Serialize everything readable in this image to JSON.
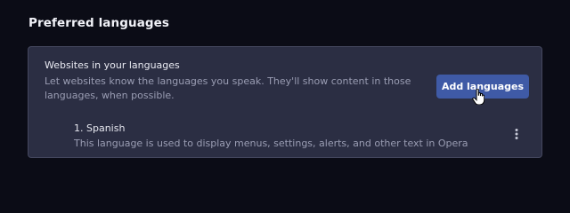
{
  "section": {
    "title": "Preferred languages"
  },
  "websites_languages": {
    "title": "Websites in your languages",
    "description": "Let websites know the languages you speak. They'll show content in those languages, when possible.",
    "add_button_label": "Add languages"
  },
  "languages": [
    {
      "label": "1. Spanish",
      "description": "This language is used to display menus, settings, alerts, and other text in Opera"
    }
  ],
  "icons": {
    "more": "more-vertical-icon",
    "cursor": "hand-pointer-cursor"
  },
  "colors": {
    "background": "#0b0c16",
    "card": "#2b2e43",
    "accent_button": "#3f5aa6",
    "secondary_text": "#9a9db3"
  }
}
